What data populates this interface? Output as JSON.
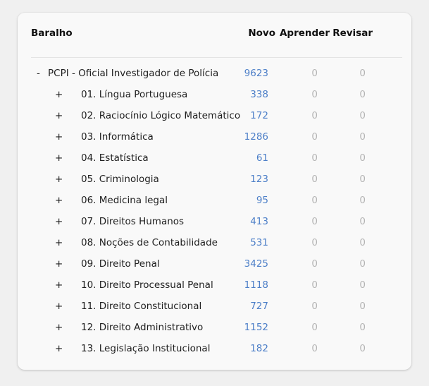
{
  "header": {
    "deck": "Baralho",
    "new": "Novo",
    "learn": "Aprender",
    "review": "Revisar"
  },
  "colors": {
    "new_count": "#4d7fc8",
    "zero_count": "#b4b4b4"
  },
  "parent": {
    "toggle": "-",
    "name": "PCPI - Oficial Investigador de Polícia",
    "new": "9623",
    "learn": "0",
    "review": "0"
  },
  "decks": [
    {
      "toggle": "+",
      "name": "01. Língua Portuguesa",
      "new": "338",
      "learn": "0",
      "review": "0"
    },
    {
      "toggle": "+",
      "name": "02. Raciocínio Lógico Matemático",
      "new": "172",
      "learn": "0",
      "review": "0"
    },
    {
      "toggle": "+",
      "name": "03. Informática",
      "new": "1286",
      "learn": "0",
      "review": "0"
    },
    {
      "toggle": "+",
      "name": "04. Estatística",
      "new": "61",
      "learn": "0",
      "review": "0"
    },
    {
      "toggle": "+",
      "name": "05. Criminologia",
      "new": "123",
      "learn": "0",
      "review": "0"
    },
    {
      "toggle": "+",
      "name": "06. Medicina legal",
      "new": "95",
      "learn": "0",
      "review": "0"
    },
    {
      "toggle": "+",
      "name": "07. Direitos Humanos",
      "new": "413",
      "learn": "0",
      "review": "0"
    },
    {
      "toggle": "+",
      "name": "08. Noções de Contabilidade",
      "new": "531",
      "learn": "0",
      "review": "0"
    },
    {
      "toggle": "+",
      "name": "09. Direito Penal",
      "new": "3425",
      "learn": "0",
      "review": "0"
    },
    {
      "toggle": "+",
      "name": "10. Direito Processual Penal",
      "new": "1118",
      "learn": "0",
      "review": "0"
    },
    {
      "toggle": "+",
      "name": "11. Direito Constitucional",
      "new": "727",
      "learn": "0",
      "review": "0"
    },
    {
      "toggle": "+",
      "name": "12. Direito Administrativo",
      "new": "1152",
      "learn": "0",
      "review": "0"
    },
    {
      "toggle": "+",
      "name": "13. Legislação Institucional",
      "new": "182",
      "learn": "0",
      "review": "0"
    }
  ]
}
